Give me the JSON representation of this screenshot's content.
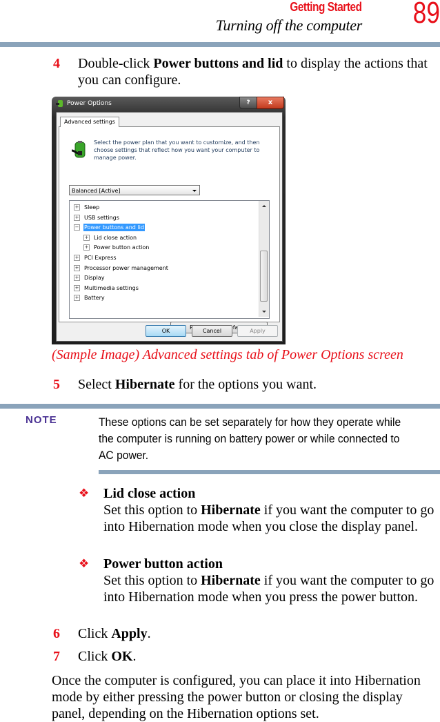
{
  "header": {
    "section": "Getting Started",
    "title": "Turning off the computer",
    "page_number": "89"
  },
  "steps": {
    "s4": {
      "num": "4",
      "pre": "Double-click ",
      "bold": "Power buttons and lid",
      "post": " to display the actions that you can configure."
    },
    "s5": {
      "num": "5",
      "pre": "Select ",
      "bold": "Hibernate",
      "post": " for the options you want."
    },
    "s6": {
      "num": "6",
      "pre": "Click ",
      "bold": "Apply",
      "post": "."
    },
    "s7": {
      "num": "7",
      "pre": "Click ",
      "bold": "OK",
      "post": "."
    }
  },
  "caption": "(Sample Image) Advanced settings tab of Power Options screen",
  "dialog": {
    "title": "Power Options",
    "help_label": "?",
    "close_label": "x",
    "tab": "Advanced settings",
    "description": "Select the power plan that you want to customize, and then choose settings that reflect how you want your computer to manage power.",
    "plan_selected": "Balanced [Active]",
    "tree": [
      {
        "label": "Sleep",
        "expander": "+",
        "level": 0,
        "selected": false
      },
      {
        "label": "USB settings",
        "expander": "+",
        "level": 0,
        "selected": false
      },
      {
        "label": "Power buttons and lid",
        "expander": "−",
        "level": 0,
        "selected": true
      },
      {
        "label": "Lid close action",
        "expander": "+",
        "level": 1,
        "selected": false
      },
      {
        "label": "Power button action",
        "expander": "+",
        "level": 1,
        "selected": false
      },
      {
        "label": "PCI Express",
        "expander": "+",
        "level": 0,
        "selected": false
      },
      {
        "label": "Processor power management",
        "expander": "+",
        "level": 0,
        "selected": false
      },
      {
        "label": "Display",
        "expander": "+",
        "level": 0,
        "selected": false
      },
      {
        "label": "Multimedia settings",
        "expander": "+",
        "level": 0,
        "selected": false
      },
      {
        "label": "Battery",
        "expander": "+",
        "level": 0,
        "selected": false
      }
    ],
    "restore_label": "Restore plan defaults",
    "ok_label": "OK",
    "cancel_label": "Cancel",
    "apply_label": "Apply"
  },
  "note": {
    "label": "NOTE",
    "text": "These options can be set separately for how they operate while the computer is running on battery power or while connected to AC power."
  },
  "bullets": [
    {
      "symbol": "❖",
      "title": "Lid close action",
      "pre": "Set this option to ",
      "bold": "Hibernate",
      "post": " if you want the computer to go into Hibernation mode when you close the display panel."
    },
    {
      "symbol": "❖",
      "title": "Power button action",
      "pre": "Set this option to ",
      "bold": "Hibernate",
      "post": " if you want the computer to go into Hibernation mode when you press the power button."
    }
  ],
  "closing_paragraph": "Once the computer is configured, you can place it into Hibernation mode by either pressing the power button or closing the display panel, depending on the Hibernation options set.",
  "colors": {
    "accent_red": "#e8101a",
    "rule": "#8aa3ba",
    "note_purple": "#4b3394",
    "selection_blue": "#3399ff"
  }
}
